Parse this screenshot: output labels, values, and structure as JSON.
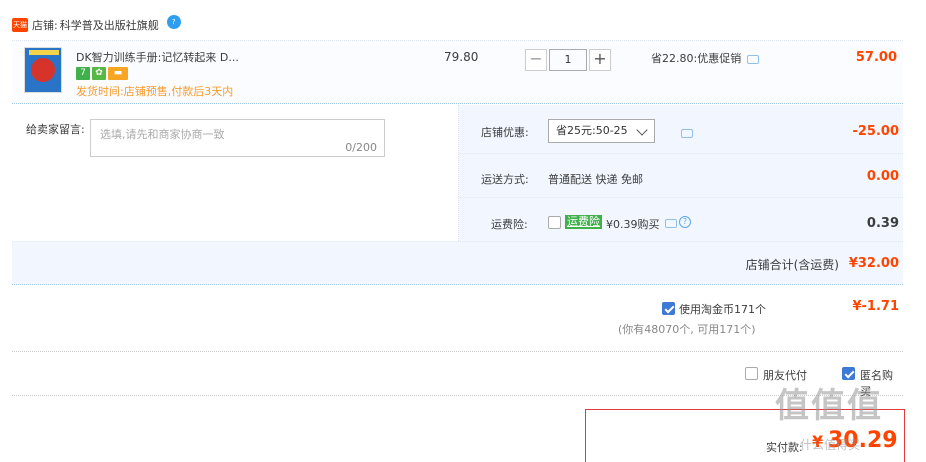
{
  "shop": {
    "badge": "天猫",
    "label": "店铺:",
    "name": "科学普及出版社旗舰",
    "chat": "?"
  },
  "item": {
    "title": "DK智力训练手册:记忆转起来 D...",
    "icons": [
      "7",
      "✿",
      "▬"
    ],
    "ship_time": "发货时间:店铺预售,付款后3天内",
    "price": "79.80",
    "qty_minus": "−",
    "qty_value": "1",
    "qty_plus": "+",
    "promo": "省22.80:优惠促销",
    "total": "57.00"
  },
  "message": {
    "label": "给卖家留言:",
    "placeholder": "选填,请先和商家协商一致",
    "count": "0/200"
  },
  "discount": {
    "label": "店铺优惠:",
    "selected": "省25元:50-25",
    "amount": "-25.00"
  },
  "shipping": {
    "label": "运送方式:",
    "value": "普通配送 快递 免邮",
    "amount": "0.00"
  },
  "insurance": {
    "label": "运费险:",
    "tag": "运费险",
    "value": "¥0.39购买",
    "help": "?",
    "amount": "0.39"
  },
  "shop_total": {
    "label": "店铺合计(含运费)",
    "value": "¥32.00"
  },
  "coins": {
    "label": "使用淘金币171个",
    "note": "(你有48070个, 可用171个)",
    "amount": "¥-1.71"
  },
  "pay": {
    "friend": "朋友代付",
    "anonymous": "匿名购买"
  },
  "final": {
    "label": "实付款:",
    "yen": "¥",
    "amount": "30.29"
  },
  "watermark": {
    "mark": "值值值",
    "site": "什么值得买"
  }
}
